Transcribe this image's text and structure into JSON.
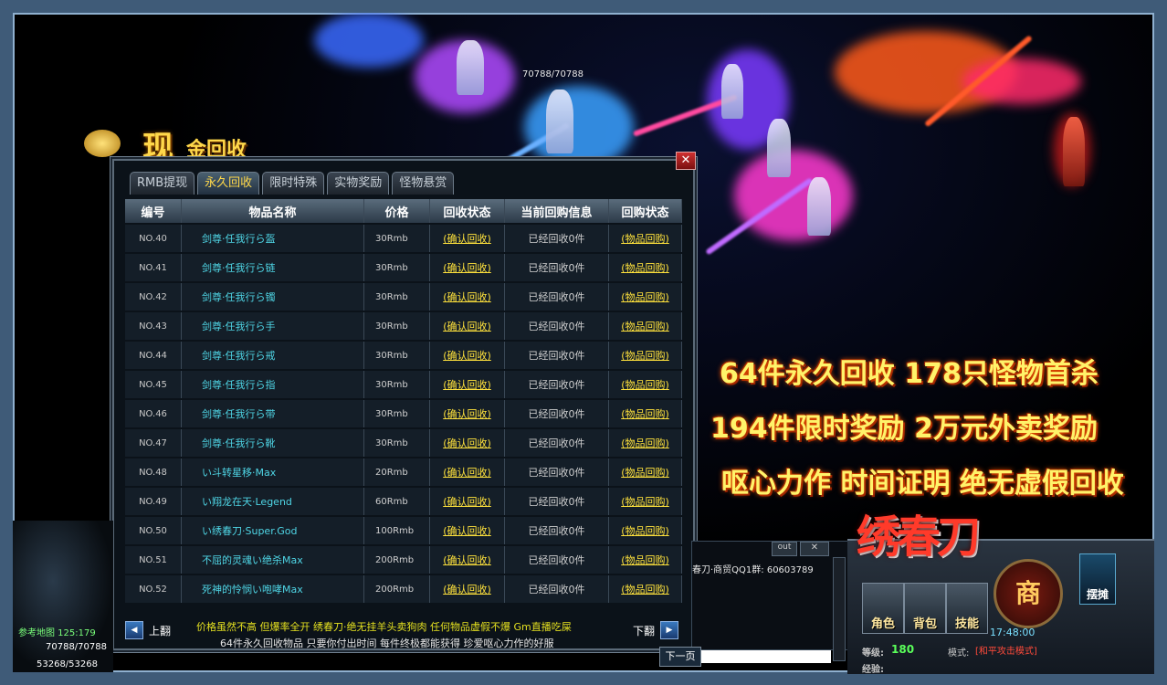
{
  "scene": {
    "hp_overhead": "70788/70788"
  },
  "logo": {
    "big_char": "现",
    "rest": "金回收"
  },
  "panel": {
    "close_label": "✕",
    "tabs": [
      {
        "label": "RMB提现",
        "active": false
      },
      {
        "label": "永久回收",
        "active": true
      },
      {
        "label": "限时特殊",
        "active": false
      },
      {
        "label": "实物奖励",
        "active": false
      },
      {
        "label": "怪物悬赏",
        "active": false
      }
    ],
    "columns": [
      "编号",
      "物品名称",
      "价格",
      "回收状态",
      "当前回购信息",
      "回购状态"
    ],
    "rows": [
      {
        "no": "NO.40",
        "name": "剑尊·任我行ら盔",
        "price": "30Rmb",
        "recycle": "(确认回收)",
        "info": "已经回收0件",
        "buyback": "(物品回购)"
      },
      {
        "no": "NO.41",
        "name": "剑尊·任我行ら链",
        "price": "30Rmb",
        "recycle": "(确认回收)",
        "info": "已经回收0件",
        "buyback": "(物品回购)"
      },
      {
        "no": "NO.42",
        "name": "剑尊·任我行ら镯",
        "price": "30Rmb",
        "recycle": "(确认回收)",
        "info": "已经回收0件",
        "buyback": "(物品回购)"
      },
      {
        "no": "NO.43",
        "name": "剑尊·任我行ら手",
        "price": "30Rmb",
        "recycle": "(确认回收)",
        "info": "已经回收0件",
        "buyback": "(物品回购)"
      },
      {
        "no": "NO.44",
        "name": "剑尊·任我行ら戒",
        "price": "30Rmb",
        "recycle": "(确认回收)",
        "info": "已经回收0件",
        "buyback": "(物品回购)"
      },
      {
        "no": "NO.45",
        "name": "剑尊·任我行ら指",
        "price": "30Rmb",
        "recycle": "(确认回收)",
        "info": "已经回收0件",
        "buyback": "(物品回购)"
      },
      {
        "no": "NO.46",
        "name": "剑尊·任我行ら带",
        "price": "30Rmb",
        "recycle": "(确认回收)",
        "info": "已经回收0件",
        "buyback": "(物品回购)"
      },
      {
        "no": "NO.47",
        "name": "剑尊·任我行ら靴",
        "price": "30Rmb",
        "recycle": "(确认回收)",
        "info": "已经回收0件",
        "buyback": "(物品回购)"
      },
      {
        "no": "NO.48",
        "name": "い斗转星移·Max",
        "price": "20Rmb",
        "recycle": "(确认回收)",
        "info": "已经回收0件",
        "buyback": "(物品回购)"
      },
      {
        "no": "NO.49",
        "name": "い翔龙在天·Legend",
        "price": "60Rmb",
        "recycle": "(确认回收)",
        "info": "已经回收0件",
        "buyback": "(物品回购)"
      },
      {
        "no": "NO.50",
        "name": "い绣春刀·Super.God",
        "price": "100Rmb",
        "recycle": "(确认回收)",
        "info": "已经回收0件",
        "buyback": "(物品回购)"
      },
      {
        "no": "NO.51",
        "name": "不屈的灵魂い绝杀Max",
        "price": "200Rmb",
        "recycle": "(确认回收)",
        "info": "已经回收0件",
        "buyback": "(物品回购)"
      },
      {
        "no": "NO.52",
        "name": "死神的怜悯い咆哮Max",
        "price": "200Rmb",
        "recycle": "(确认回收)",
        "info": "已经回收0件",
        "buyback": "(物品回购)"
      }
    ],
    "prev_label": "上翻",
    "next_label": "下翻",
    "note1": "价格虽然不高 但爆率全开 绣春刀·绝无挂羊头卖狗肉 任何物品虚假不爆 Gm直播吃屎",
    "note2": "64件永久回收物品 只要你付出时间 每件终极都能获得 珍爱呕心力作的好服"
  },
  "promo": {
    "line1": "64件永久回收 178只怪物首杀",
    "line2": "194件限时奖励 2万元外卖奖励",
    "line3": "呕心力作 时间证明 绝无虚假回收"
  },
  "chat": {
    "out_label": "out",
    "close_label": "✕",
    "line": "春刀·商贸QQ1群: 60603789",
    "next_page": "下一页"
  },
  "hud": {
    "game_logo": "绣春刀",
    "buttons": [
      {
        "label": "角色"
      },
      {
        "label": "背包"
      },
      {
        "label": "技能"
      }
    ],
    "shop": "商",
    "stall": "摆摊",
    "clock": "17:48:00",
    "level_label": "等级:",
    "level": "180",
    "mode_label": "模式:",
    "mode": "[和平攻击模式]",
    "exp_label": "经验:"
  },
  "bottom_left": {
    "map": "参考地图 125:179",
    "hp": "70788/70788",
    "mp": "53268/53268"
  }
}
